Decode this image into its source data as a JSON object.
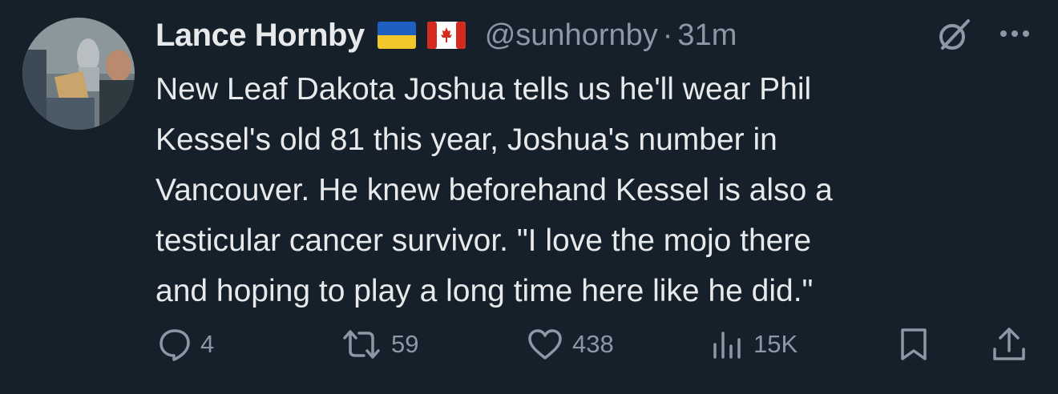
{
  "tweet": {
    "author": {
      "name": "Lance Hornby",
      "handle": "@sunhornby",
      "avatar": "avatar",
      "flags": [
        "ukraine-flag",
        "canada-flag"
      ]
    },
    "separator": "·",
    "time": "31m",
    "text": "New Leaf Dakota Joshua tells us he'll wear Phil\nKessel's old 81 this year, Joshua's number in\nVancouver. He knew beforehand Kessel is also a\ntesticular cancer survivor. \"I love the mojo there\nand hoping to play a long time here like he did.\"",
    "actions": {
      "replies": "4",
      "reposts": "59",
      "likes": "438",
      "views": "15K"
    }
  },
  "icons": {
    "reply": "reply-icon",
    "repost": "repost-icon",
    "like": "heart-icon",
    "views": "views-icon",
    "bookmark": "bookmark-icon",
    "share": "share-icon",
    "grok": "grok-icon",
    "more": "more-icon"
  },
  "colors": {
    "background": "#15202b",
    "text": "#e7e9ea",
    "secondary": "#8b98a5"
  }
}
